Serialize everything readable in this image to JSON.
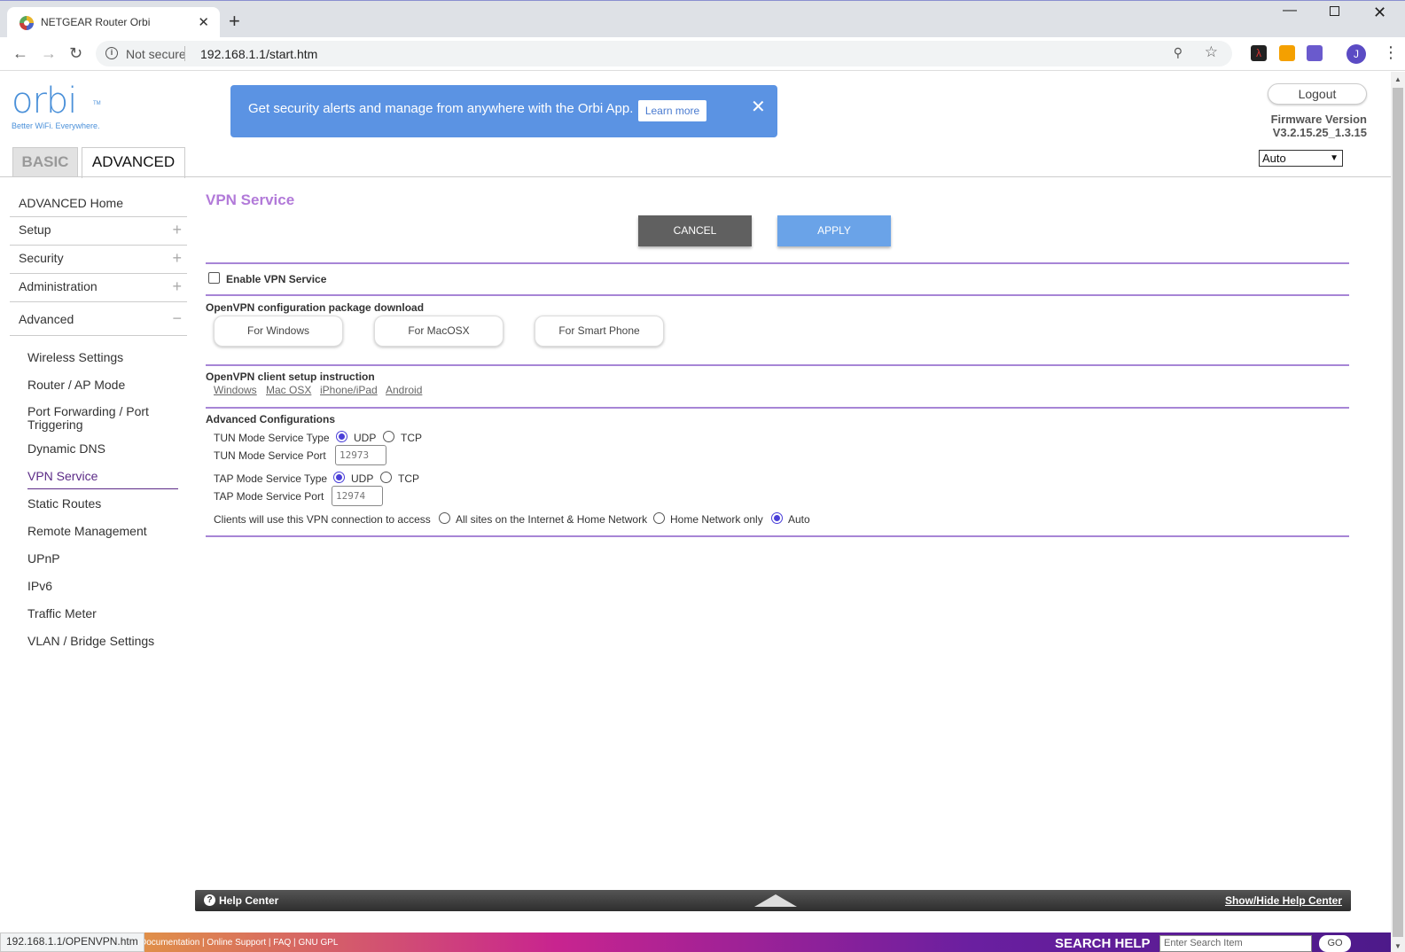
{
  "browser": {
    "tab_title": "NETGEAR Router Orbi",
    "tab_close": "✕",
    "new_tab": "+",
    "security_label": "Not secure",
    "url": "192.168.1.1/start.htm",
    "profile_initial": "J",
    "status_url": "192.168.1.1/OPENVPN.htm"
  },
  "header": {
    "logo_text": "orbi",
    "logo_tm": "TM",
    "tagline": "Better WiFi. Everywhere.",
    "banner_message": "Get security alerts and manage from anywhere with the Orbi App.",
    "banner_button": "Learn more",
    "logout_label": "Logout",
    "firmware_label": "Firmware Version",
    "firmware_value": "V3.2.15.25_1.3.15",
    "language_selected": "Auto",
    "tabs": [
      {
        "label": "BASIC",
        "active": false
      },
      {
        "label": "ADVANCED",
        "active": true
      }
    ]
  },
  "sidebar": {
    "top_items": [
      {
        "label": "ADVANCED Home",
        "expander": ""
      },
      {
        "label": "Setup",
        "expander": "+"
      },
      {
        "label": "Security",
        "expander": "+"
      },
      {
        "label": "Administration",
        "expander": "+"
      },
      {
        "label": "Advanced",
        "expander": "−"
      }
    ],
    "sub_items": [
      {
        "label": "Wireless Settings"
      },
      {
        "label": "Router / AP Mode"
      },
      {
        "label": "Port Forwarding / Port Triggering"
      },
      {
        "label": "Dynamic DNS"
      },
      {
        "label": "VPN Service",
        "active": true
      },
      {
        "label": "Static Routes"
      },
      {
        "label": "Remote Management"
      },
      {
        "label": "UPnP"
      },
      {
        "label": "IPv6"
      },
      {
        "label": "Traffic Meter"
      },
      {
        "label": "VLAN / Bridge Settings"
      }
    ]
  },
  "main": {
    "title": "VPN Service",
    "cancel_label": "CANCEL",
    "apply_label": "APPLY",
    "enable_label": "Enable VPN Service",
    "enable_checked": false,
    "download_heading": "OpenVPN configuration package download",
    "download_buttons": [
      "For Windows",
      "For MacOSX",
      "For Smart Phone"
    ],
    "instruction_heading": "OpenVPN client setup instruction",
    "instruction_links": [
      "Windows",
      "Mac OSX",
      "iPhone/iPad",
      "Android"
    ],
    "advanced_heading": "Advanced Configurations",
    "tun_type_label": "TUN Mode Service Type",
    "tun_port_label": "TUN Mode Service Port",
    "tun_port_value": "12973",
    "tap_type_label": "TAP Mode Service Type",
    "tap_port_label": "TAP Mode Service Port",
    "tap_port_value": "12974",
    "udp_label": "UDP",
    "tcp_label": "TCP",
    "tun_type_selected": "UDP",
    "tap_type_selected": "UDP",
    "clients_label": "Clients will use this VPN connection to access",
    "access_options": [
      "All sites on the Internet & Home Network",
      "Home Network only",
      "Auto"
    ],
    "access_selected": "Auto"
  },
  "help": {
    "title": "Help Center",
    "toggle_label": "Show/Hide Help Center"
  },
  "footer": {
    "links": "Documentation | Online Support | FAQ | GNU GPL",
    "search_heading": "SEARCH HELP",
    "search_placeholder": "Enter Search Item",
    "go_label": "GO"
  },
  "colors": {
    "accent_purple": "#a785d6",
    "title_purple": "#b27ad9",
    "apply_blue": "#6aa3e8",
    "banner_blue": "#5b93e3",
    "cancel_gray": "#606060"
  }
}
